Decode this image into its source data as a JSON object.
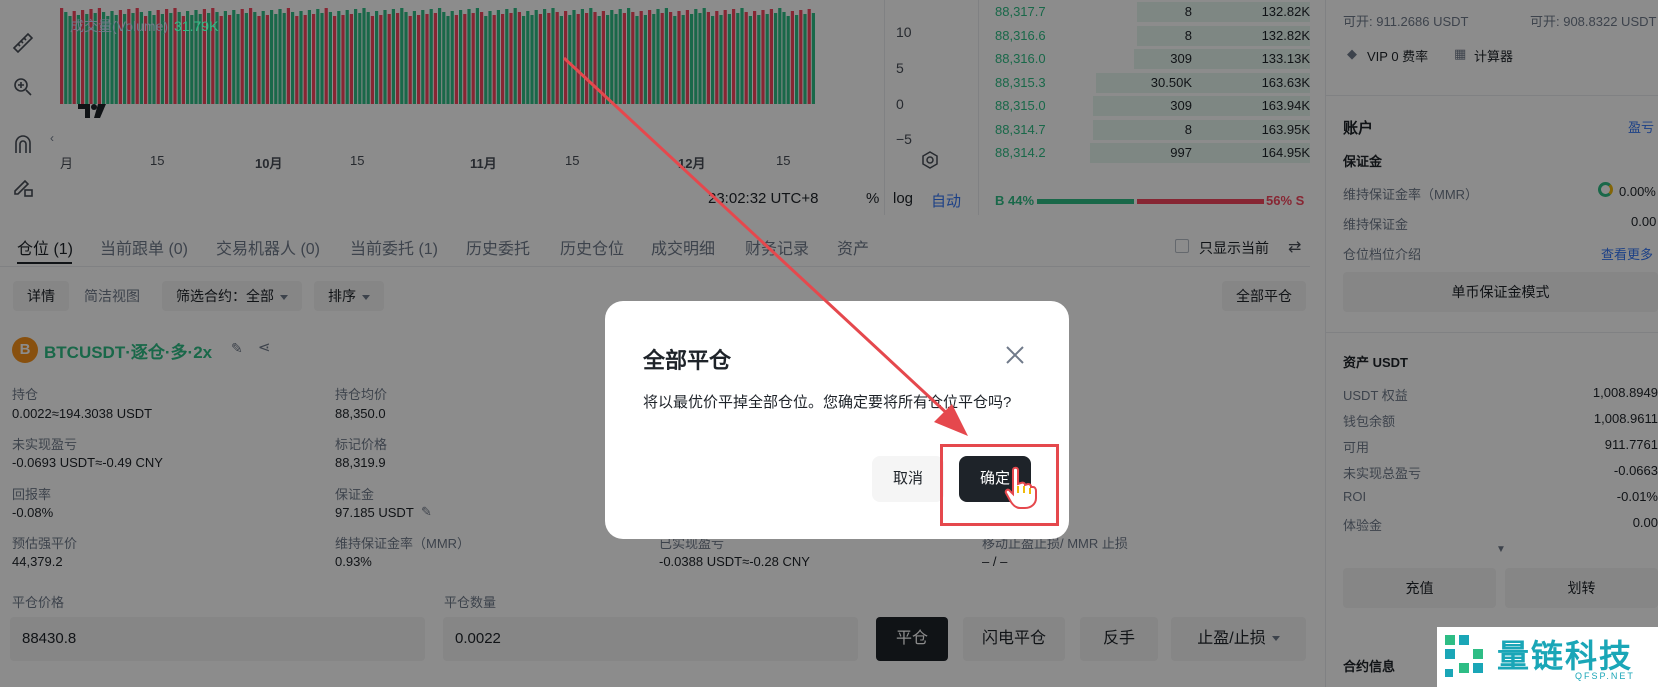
{
  "chart": {
    "volume_label": "成交量(Volume)",
    "volume_value": "31.79K",
    "x_ticks": [
      {
        "label": "月",
        "bold": false
      },
      {
        "label": "15",
        "bold": false
      },
      {
        "label": "10月",
        "bold": true
      },
      {
        "label": "15",
        "bold": false
      },
      {
        "label": "11月",
        "bold": true
      },
      {
        "label": "15",
        "bold": false
      },
      {
        "label": "12月",
        "bold": true
      },
      {
        "label": "15",
        "bold": false
      }
    ],
    "y_ticks": [
      "10",
      "5",
      "0",
      "−5"
    ],
    "time": "23:02:32 UTC+8",
    "percent": "%",
    "log": "log",
    "auto": "自动",
    "tv_logo": "TV"
  },
  "orderbook": {
    "rows": [
      {
        "price": "88,317.7",
        "qty": "8",
        "total": "132.82K",
        "depth": 0.55
      },
      {
        "price": "88,316.6",
        "qty": "8",
        "total": "132.82K",
        "depth": 0.55
      },
      {
        "price": "88,316.0",
        "qty": "309",
        "total": "133.13K",
        "depth": 0.56
      },
      {
        "price": "88,315.3",
        "qty": "30.50K",
        "total": "163.63K",
        "depth": 0.68
      },
      {
        "price": "88,315.0",
        "qty": "309",
        "total": "163.94K",
        "depth": 0.69
      },
      {
        "price": "88,314.7",
        "qty": "8",
        "total": "163.95K",
        "depth": 0.69
      },
      {
        "price": "88,314.2",
        "qty": "997",
        "total": "164.95K",
        "depth": 0.7
      }
    ],
    "buy_ratio": "B 44%",
    "sell_ratio": "56% S",
    "buy_fraction": 0.44
  },
  "tabs": [
    {
      "label": "仓位 (1)",
      "active": true
    },
    {
      "label": "当前跟单 (0)",
      "active": false
    },
    {
      "label": "交易机器人 (0)",
      "active": false
    },
    {
      "label": "当前委托 (1)",
      "active": false
    },
    {
      "label": "历史委托",
      "active": false
    },
    {
      "label": "历史仓位",
      "active": false
    },
    {
      "label": "成交明细",
      "active": false
    },
    {
      "label": "财务记录",
      "active": false
    },
    {
      "label": "资产",
      "active": false
    }
  ],
  "show_current_only": "只显示当前",
  "filters": {
    "detail": "详情",
    "simple_view": "简洁视图",
    "filter_contract": "筛选合约：全部",
    "sort": "排序",
    "close_all": "全部平仓"
  },
  "position": {
    "btc_icon": "B",
    "title": "BTCUSDT·逐仓·多·2x",
    "fields": {
      "holding_label": "持仓",
      "holding_value": "0.0022≈194.3038 USDT",
      "avg_price_label": "持仓均价",
      "avg_price_value": "88,350.0",
      "unrealized_label": "未实现盈亏",
      "unrealized_value": "-0.0693 USDT≈-0.49 CNY",
      "mark_price_label": "标记价格",
      "mark_price_value": "88,319.9",
      "roe_label": "回报率",
      "roe_value": "-0.08%",
      "margin_label": "保证金",
      "margin_value": "97.185 USDT",
      "liq_label": "预估强平价",
      "liq_value": "44,379.2",
      "mmr_label": "维持保证金率（MMR）",
      "mmr_value": "0.93%",
      "realized_label": "已实现盈亏",
      "realized_value": "-0.0388 USDT≈-0.28 CNY",
      "tpsl_label": "移动止盈止损/ MMR 止损",
      "tpsl_value": "– / –"
    },
    "close_price_label": "平仓价格",
    "close_price_value": "88430.8",
    "close_qty_label": "平仓数量",
    "close_qty_value": "0.0022",
    "btn_close": "平仓",
    "btn_flash_close": "闪电平仓",
    "btn_reverse": "反手",
    "btn_tpsl": "止盈/止损"
  },
  "right_panel": {
    "avail_open_1": "可开: 911.2686 USDT",
    "avail_open_2": "可开: 908.8322 USDT",
    "vip": "VIP 0 费率",
    "calculator": "计算器",
    "account_title": "账户",
    "account_link": "盈亏",
    "margin_title": "保证金",
    "mmr_label": "维持保证金率（MMR）",
    "mmr_value": "0.00%",
    "maint_margin_label": "维持保证金",
    "maint_margin_value": "0.00",
    "tier_label": "仓位档位介绍",
    "tier_link": "查看更多",
    "single_margin_mode": "单币保证金模式",
    "assets_title": "资产 USDT",
    "assets": [
      {
        "label": "USDT 权益",
        "value": "1,008.8949"
      },
      {
        "label": "钱包余额",
        "value": "1,008.9611"
      },
      {
        "label": "可用",
        "value": "911.7761"
      },
      {
        "label": "未实现总盈亏",
        "value": "-0.0663"
      },
      {
        "label": "ROI",
        "value": "-0.01%"
      },
      {
        "label": "体验金",
        "value": "0.00"
      }
    ],
    "deposit": "充值",
    "transfer": "划转",
    "contract_info": "合约信息"
  },
  "modal": {
    "title": "全部平仓",
    "message": "将以最优价平掉全部仓位。您确定要将所有仓位平仓吗?",
    "cancel": "取消",
    "confirm": "确定"
  },
  "watermark": {
    "text": "量链科技",
    "sub": "QFSP.NET"
  },
  "colors": {
    "green": "#2ebd85",
    "red": "#f6465d",
    "annotation": "#e5484d"
  }
}
